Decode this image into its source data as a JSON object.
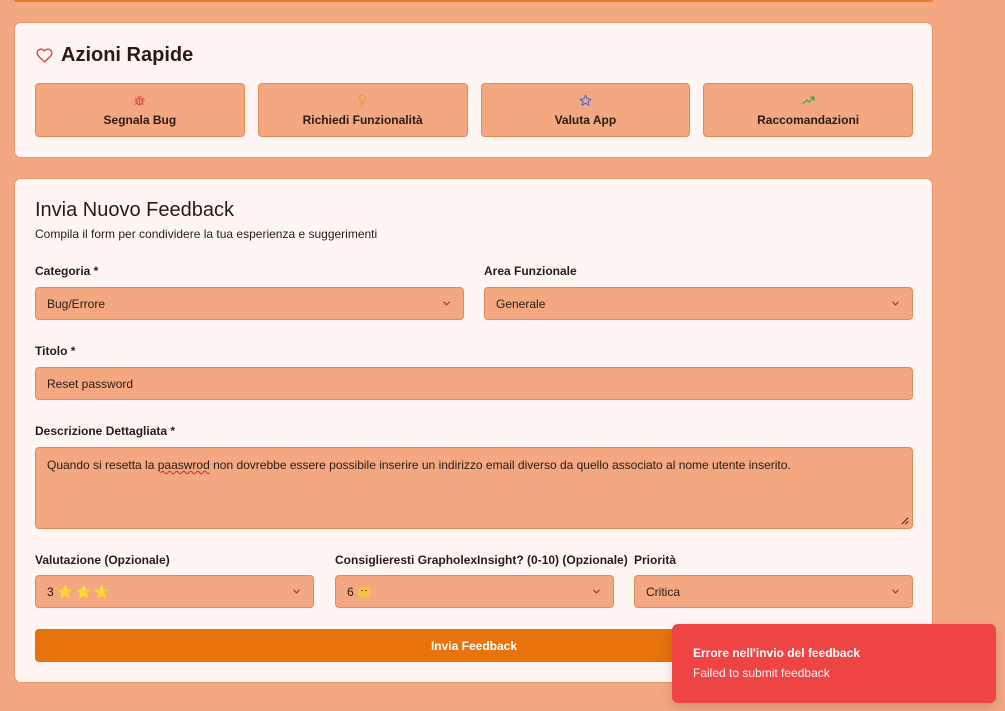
{
  "quick_actions": {
    "title": "Azioni Rapide",
    "items": [
      {
        "label": "Segnala Bug",
        "icon": "bug-icon",
        "color": "#e24a3a"
      },
      {
        "label": "Richiedi Funzionalità",
        "icon": "lightbulb-icon",
        "color": "#e8a818"
      },
      {
        "label": "Valuta App",
        "icon": "star-icon",
        "color": "#3b6fd8"
      },
      {
        "label": "Raccomandazioni",
        "icon": "trending-up-icon",
        "color": "#3aa84a"
      }
    ]
  },
  "form": {
    "title": "Invia Nuovo Feedback",
    "subtitle": "Compila il form per condividere la tua esperienza e suggerimenti",
    "category": {
      "label": "Categoria *",
      "value": "Bug/Errore"
    },
    "area": {
      "label": "Area Funzionale",
      "value": "Generale"
    },
    "title_field": {
      "label": "Titolo *",
      "value": "Reset password"
    },
    "description": {
      "label": "Descrizione Dettagliata *",
      "before": "Quando si resetta la ",
      "typo": "paaswrod",
      "after": " non dovrebbe essere possibile inserire un indirizzo email diverso da quello associato al nome utente inserito."
    },
    "rating": {
      "label": "Valutazione (Opzionale)",
      "value": "3",
      "stars": "⭐ ⭐ ⭐"
    },
    "recommend": {
      "label": "Consiglieresti GrapholexInsight? (0-10) (Opzionale)",
      "value": "6"
    },
    "priority": {
      "label": "Priorità",
      "value": "Critica"
    },
    "submit_label": "Invia Feedback"
  },
  "toast": {
    "title": "Errore nell'invio del feedback",
    "message": "Failed to submit feedback",
    "color": "#ef4444"
  },
  "colors": {
    "background": "#f3a882",
    "card": "#fff6f3",
    "accent": "#e8720c"
  }
}
